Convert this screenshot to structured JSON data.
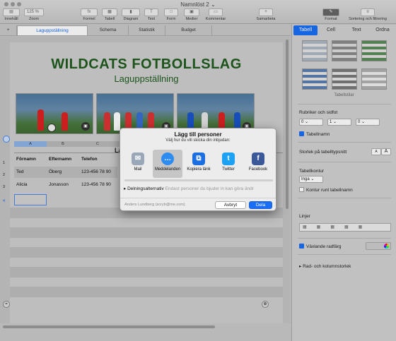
{
  "window": {
    "title": "Namnlöst 2"
  },
  "toolbar": {
    "left": [
      {
        "label": "Innehåll",
        "icon": "sidebar-icon"
      },
      {
        "label": "Zoom",
        "value": "125 %"
      }
    ],
    "center": [
      {
        "label": "Formel",
        "icon": "formula-icon",
        "glyph": "fx"
      },
      {
        "label": "Tabell",
        "icon": "table-icon",
        "glyph": "▦"
      },
      {
        "label": "Diagram",
        "icon": "chart-icon",
        "glyph": "▮"
      },
      {
        "label": "Text",
        "icon": "text-icon",
        "glyph": "T"
      },
      {
        "label": "Form",
        "icon": "shape-icon",
        "glyph": "□"
      },
      {
        "label": "Medier",
        "icon": "media-icon",
        "glyph": "▣"
      },
      {
        "label": "Kommentar",
        "icon": "comment-icon",
        "glyph": "▭"
      }
    ],
    "right": [
      {
        "label": "Samarbeta",
        "icon": "collaborate-icon",
        "glyph": "+"
      },
      {
        "label": "Format",
        "icon": "format-icon",
        "glyph": "✎"
      },
      {
        "label": "Sortering och filtrering",
        "icon": "sort-icon",
        "glyph": "≡"
      }
    ]
  },
  "sheets": {
    "add": "+",
    "tabs": [
      "Laguppställning",
      "Schema",
      "Statistik",
      "Budget"
    ],
    "active": 0
  },
  "document": {
    "title": "WILDCATS FOTBOLLSLAG",
    "subtitle": "Laguppställning",
    "table_title_fragment": "La",
    "column_headers": [
      "A",
      "B",
      "C"
    ],
    "header_row": [
      "Förnamn",
      "Efternamn",
      "Telefon"
    ],
    "rows": [
      [
        "Ted",
        "Öberg",
        "123-456 78 90"
      ],
      [
        "Alicia",
        "Jonasson",
        "123-456 78 90"
      ]
    ],
    "row_numbers": [
      "1",
      "2",
      "3",
      "4"
    ]
  },
  "sidebar": {
    "tabs": [
      "Tabell",
      "Cell",
      "Text",
      "Ordna"
    ],
    "active_tab": 0,
    "styles_label": "Tabellstilar",
    "headers_section": "Rubriker och sidfot",
    "header_values": [
      "0",
      "1",
      "0"
    ],
    "table_name_label": "Tabellnamn",
    "table_name_checked": true,
    "font_size_label": "Storlek på tabelltypsnitt",
    "font_small": "A",
    "font_large": "A",
    "outline_section": "Tabellkontur",
    "outline_value": "Inga",
    "outline_name_label": "Kontur runt tabellnamn",
    "outline_name_checked": false,
    "lines_section": "Linjer",
    "alternating_label": "Växlande radfärg",
    "alternating_checked": true,
    "row_col_size": "Rad- och kolumnstorlek"
  },
  "dialog": {
    "title": "Lägg till personer",
    "subtitle": "Välj hur du vill skicka din inbjudan:",
    "options": [
      {
        "label": "Mail",
        "icon": "mail-icon",
        "glyph": "✉",
        "color": "#9aa7b8"
      },
      {
        "label": "Meddelanden",
        "icon": "messages-icon",
        "glyph": "…",
        "color": "#2e8cf0"
      },
      {
        "label": "Kopiera länk",
        "icon": "copy-link-icon",
        "glyph": "⧉",
        "color": "#1b6fe0"
      },
      {
        "label": "Twitter",
        "icon": "twitter-icon",
        "glyph": "t",
        "color": "#1da1f2"
      },
      {
        "label": "Facebook",
        "icon": "facebook-icon",
        "glyph": "f",
        "color": "#3b5998"
      }
    ],
    "selected_option": 1,
    "share_options_label": "Delningsalternativ",
    "share_options_placeholder": "Endast personer du bjuder in kan göra ändr",
    "account": "Anders Lundberg (scryb@me.com)",
    "cancel": "Avbryt",
    "share": "Dela"
  },
  "colors": {
    "accent": "#1a6ef5",
    "title_green": "#1f5c1f"
  }
}
